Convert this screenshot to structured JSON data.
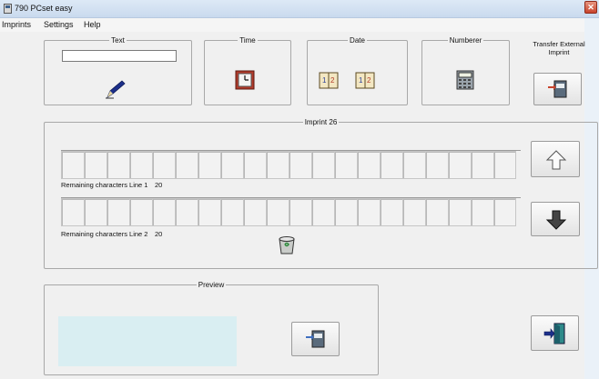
{
  "window": {
    "title": "790 PCset easy",
    "close_label": "✕"
  },
  "menu": {
    "items": [
      "Imprints",
      "Settings",
      "Help"
    ]
  },
  "groups": {
    "text": {
      "label": "Text",
      "value": ""
    },
    "time": {
      "label": "Time"
    },
    "date": {
      "label": "Date"
    },
    "numberer": {
      "label": "Numberer"
    },
    "transfer": {
      "label": "Transfer External Imprint"
    },
    "imprint": {
      "label": "Imprint 26"
    },
    "preview": {
      "label": "Preview"
    }
  },
  "lines": [
    {
      "label": "Remaining characters Line 1",
      "count": "20"
    },
    {
      "label": "Remaining characters Line 2",
      "count": "20"
    }
  ],
  "icons": {
    "text_tool": "pen-icon",
    "time_tool": "clock-icon",
    "date_tool": "calendar-icon",
    "numberer_tool": "calculator-icon",
    "transfer": "transfer-icon",
    "up": "arrow-up-icon",
    "down": "arrow-down-icon",
    "delete": "trash-icon",
    "preview_transfer": "transfer-icon",
    "exit": "exit-door-icon"
  },
  "colors": {
    "preview_bg": "#d9eef2",
    "accent_red": "#c8432b"
  }
}
